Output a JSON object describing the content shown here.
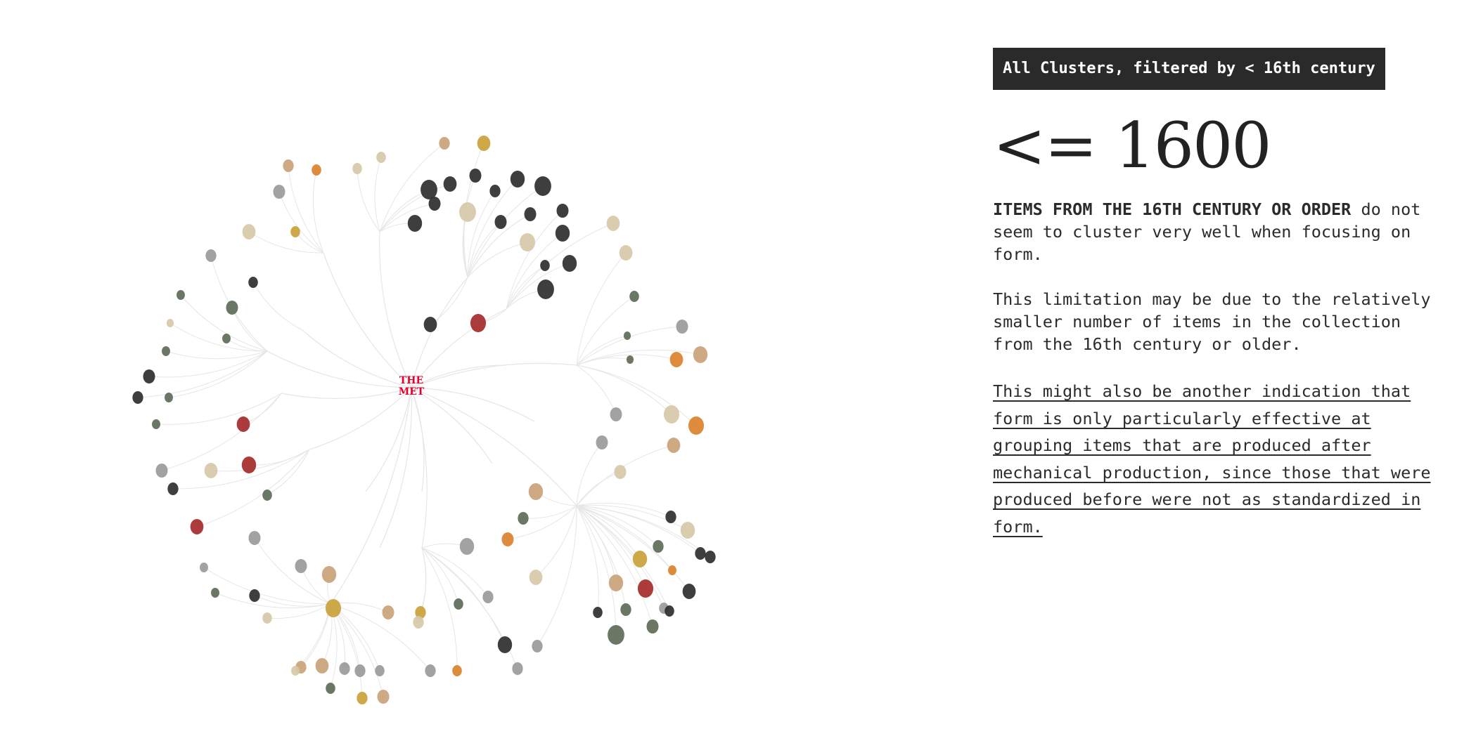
{
  "filter_tag": "All Clusters, filtered by < 16th century",
  "headline": "<= 1600",
  "paragraph1": {
    "emphasis": "ITEMS FROM THE 16TH CENTURY OR ORDER",
    "rest": " do not seem to cluster very well when focusing on form."
  },
  "paragraph2": "This limitation may be due to the relatively smaller number of items in the collection from the 16th century or older.",
  "paragraph3": " This might also be another indication that form is only particularly effective at grouping items that are produced after mechanical production, since those that were produced before were not as standardized in form.",
  "logo": {
    "line1": "THE",
    "line2": "MET",
    "color": "#e4002b"
  },
  "colors": {
    "link": "#e6e6e6",
    "leather": "#c9a37a",
    "bronze": "#5d6b57",
    "iron": "#2e2e2e",
    "linen": "#d6c8a8",
    "red": "#a52a2a",
    "orange": "#d9822b",
    "gold": "#c9a23a",
    "silver": "#9a9a9a"
  }
}
